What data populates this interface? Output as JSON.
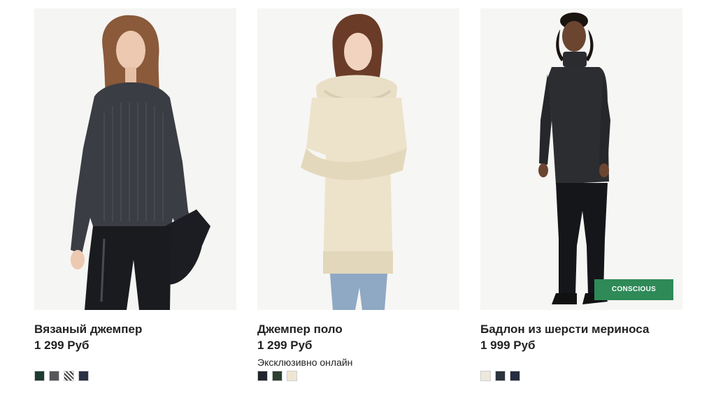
{
  "products": [
    {
      "name": "Вязаный джемпер",
      "price": "1 299 Руб",
      "note": "",
      "badge": "",
      "swatches": [
        "#1f3a2e",
        "#55575a",
        "pattern",
        "#2b3144"
      ]
    },
    {
      "name": "Джемпер поло",
      "price": "1 299 Руб",
      "note": "Эксклюзивно онлайн",
      "badge": "",
      "swatches": [
        "#22252c",
        "#2c3f31",
        "#efe6d2"
      ]
    },
    {
      "name": "Бадлон из шерсти мериноса",
      "price": "1 999 Руб",
      "note": "",
      "badge": "CONSCIOUS",
      "swatches": [
        "#eee8dc",
        "#2c333b",
        "#272d40"
      ]
    }
  ],
  "colors": {
    "badge_bg": "#2e8a57",
    "photo_bg": "#f4f4f2",
    "text": "#222222"
  }
}
